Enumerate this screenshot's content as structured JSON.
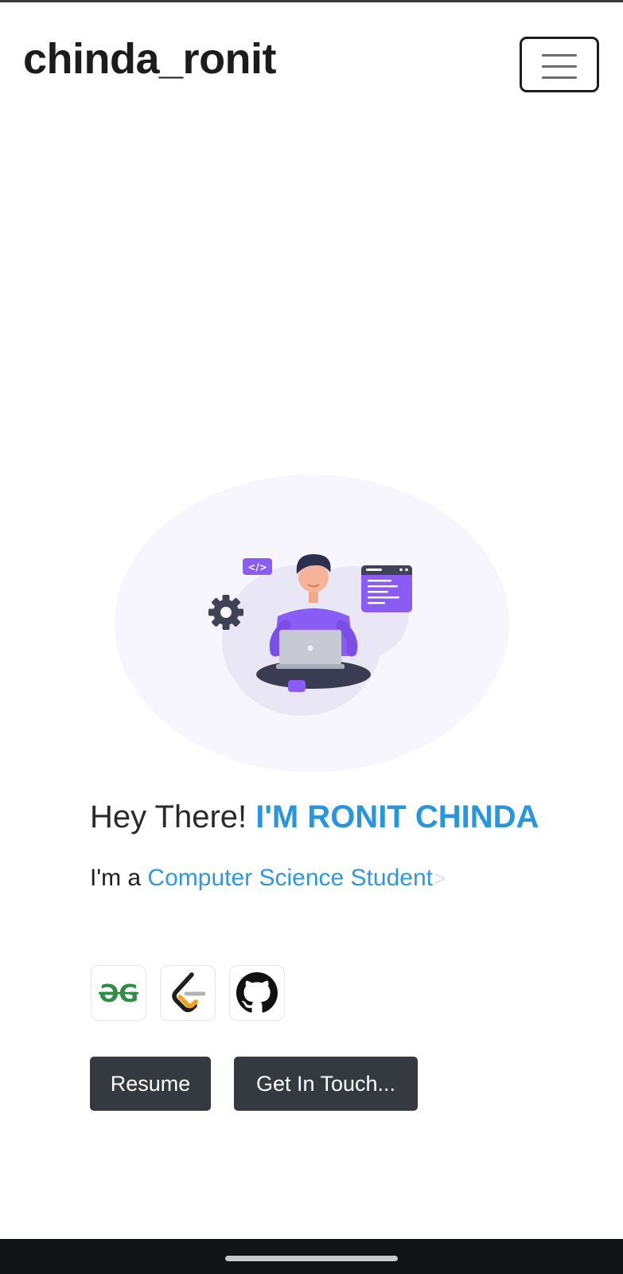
{
  "navbar": {
    "brand": "chinda_ronit"
  },
  "hero": {
    "greeting": "Hey There! ",
    "name": "I'M RONIT CHINDA",
    "role_prefix": "I'm a ",
    "role": "Computer Science Student",
    "typing_caret": ">",
    "illustration_code_tag": "</>"
  },
  "social": [
    {
      "icon": "geeksforgeeks-icon",
      "logo_text": "ƏG",
      "color": "#2f8d46"
    },
    {
      "icon": "leetcode-icon",
      "color_dark": "#1f1f1f",
      "color_accent": "#f0a31a",
      "color_gray": "#b3b3b3"
    },
    {
      "icon": "github-icon",
      "color": "#111111"
    }
  ],
  "actions": {
    "resume_label": "Resume",
    "contact_label": "Get In Touch..."
  },
  "colors": {
    "accent": "#2895e0",
    "button_bg": "#343a40",
    "illustration_purple": "#8a5cf6"
  }
}
